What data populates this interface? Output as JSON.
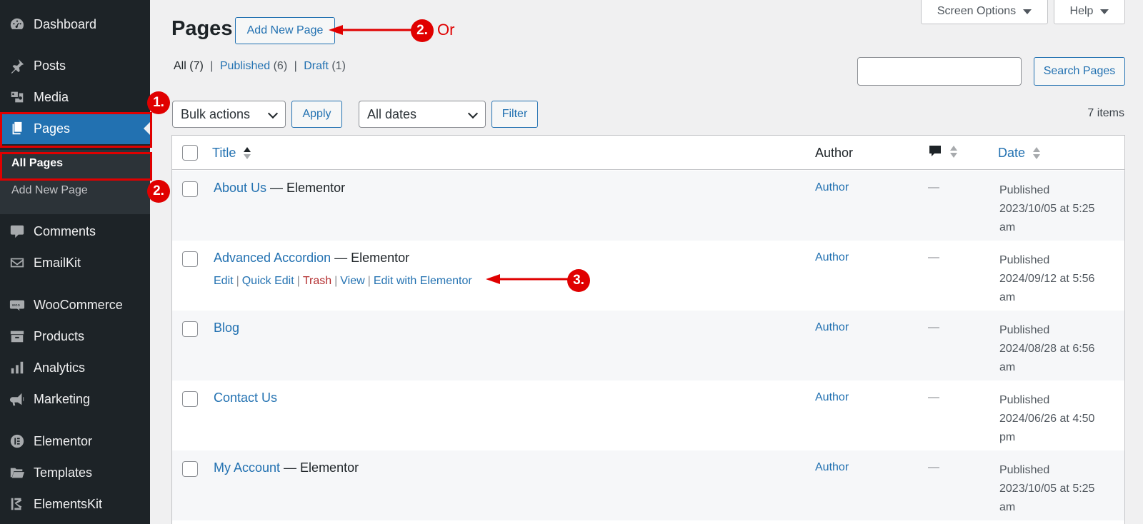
{
  "sidebar": {
    "items": [
      {
        "label": "Dashboard",
        "icon": "dashboard-icon"
      },
      {
        "label": "Posts",
        "icon": "pin-icon"
      },
      {
        "label": "Media",
        "icon": "media-icon"
      },
      {
        "label": "Pages",
        "icon": "pages-icon"
      },
      {
        "label": "Comments",
        "icon": "comment-icon"
      },
      {
        "label": "EmailKit",
        "icon": "email-icon"
      },
      {
        "label": "WooCommerce",
        "icon": "woo-icon"
      },
      {
        "label": "Products",
        "icon": "archive-icon"
      },
      {
        "label": "Analytics",
        "icon": "bar-chart-icon"
      },
      {
        "label": "Marketing",
        "icon": "megaphone-icon"
      },
      {
        "label": "Elementor",
        "icon": "elementor-icon"
      },
      {
        "label": "Templates",
        "icon": "folder-icon"
      },
      {
        "label": "ElementsKit",
        "icon": "elementskit-icon"
      }
    ],
    "submenu": {
      "all_pages": "All Pages",
      "add_new_page": "Add New Page"
    }
  },
  "header": {
    "title": "Pages",
    "add_new": "Add New Page",
    "screen_options": "Screen Options",
    "help": "Help",
    "search_button": "Search Pages",
    "search_placeholder": ""
  },
  "filters": {
    "all_label": "All",
    "all_count": "(7)",
    "published_label": "Published",
    "published_count": "(6)",
    "draft_label": "Draft",
    "draft_count": "(1)",
    "sep": "|",
    "bulk_actions": "Bulk actions",
    "apply": "Apply",
    "dates": "All dates",
    "filter": "Filter",
    "items_count": "7 items"
  },
  "table": {
    "columns": {
      "title": "Title",
      "author": "Author",
      "date": "Date"
    },
    "rows": [
      {
        "title": "About Us",
        "suffix": " — Elementor",
        "author": "Author",
        "comments": "—",
        "status": "Published",
        "date": "2023/10/05 at 5:25",
        "time_suffix": "am"
      },
      {
        "title": "Advanced Accordion",
        "suffix": " — Elementor",
        "author": "Author",
        "comments": "—",
        "status": "Published",
        "date": "2024/09/12 at 5:56",
        "time_suffix": "am"
      },
      {
        "title": "Blog",
        "suffix": "",
        "author": "Author",
        "comments": "—",
        "status": "Published",
        "date": "2024/08/28 at 6:56",
        "time_suffix": "am"
      },
      {
        "title": "Contact Us",
        "suffix": "",
        "author": "Author",
        "comments": "—",
        "status": "Published",
        "date": "2024/06/26 at 4:50",
        "time_suffix": "pm"
      },
      {
        "title": "My Account",
        "suffix": " — Elementor",
        "author": "Author",
        "comments": "—",
        "status": "Published",
        "date": "2023/10/05 at 5:25",
        "time_suffix": "am"
      }
    ],
    "row_actions": {
      "edit": "Edit",
      "quick_edit": "Quick Edit",
      "trash": "Trash",
      "view": "View",
      "edit_elementor": "Edit with Elementor",
      "sep": "|"
    }
  },
  "annotations": {
    "badge_1": "1.",
    "badge_2a": "2.",
    "badge_2b": "2.",
    "badge_3": "3.",
    "or": "Or"
  },
  "colors": {
    "accent": "#2271b1",
    "sidebar_bg": "#1d2327",
    "annotation_red": "#e00000",
    "trash": "#b32d2e"
  }
}
